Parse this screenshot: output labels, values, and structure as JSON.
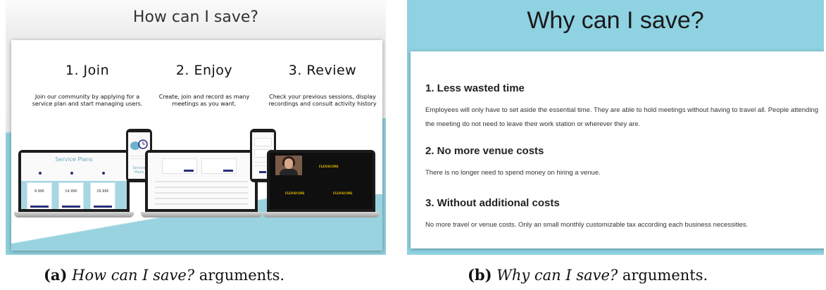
{
  "panel_a": {
    "title": "How can I save?",
    "steps": [
      {
        "title": "1. Join",
        "desc": "Join our community by applying for a service plan and start managing users."
      },
      {
        "title": "2. Enjoy",
        "desc": "Create, join and record as many meetings as you want."
      },
      {
        "title": "3. Review",
        "desc": "Check your previous sessions, display recordings and consult activity history"
      }
    ],
    "mockup": {
      "service_plans_title": "Service Plans",
      "plan_prices": [
        "9.99€",
        "14.99€",
        "29.99€"
      ],
      "phone1_label": "Service Plans",
      "video_brand": "FLEXISCORE"
    }
  },
  "panel_b": {
    "title": "Why can I save?",
    "reasons": [
      {
        "title": "1. Less wasted time",
        "desc": "Employees will only have to set aside the essential time. They are able to hold meetings without having to travel all. People attending the meeting do not need to leave their work station or wherever they are."
      },
      {
        "title": "2. No more venue costs",
        "desc": "There is no longer need to spend money on hiring a venue."
      },
      {
        "title": "3. Without additional costs",
        "desc": "No more travel or venue costs. Only an small monthly customizable tax according each business necessities."
      }
    ]
  },
  "captions": {
    "a_label": "(a)",
    "a_italic": "How can I save?",
    "a_rest": " arguments.",
    "b_label": "(b)",
    "b_italic": "Why can I save?",
    "b_rest": " arguments."
  }
}
